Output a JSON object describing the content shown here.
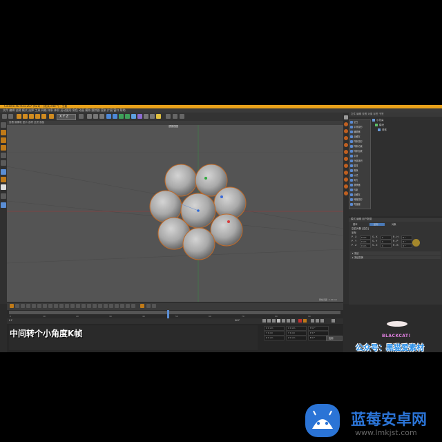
{
  "window": {
    "title": "Cinema 4D R21.207 (R21) - [花朵.c4d *] - 主要",
    "menu": "文件  编辑  创建  模式  选择  工具  网格  样条  体积  运动图形  角色  动画  模拟  跟踪器  渲染  扩展  窗口  帮助",
    "accent_color": "#e8a11a"
  },
  "toolbar": {
    "axis_labels": "X Y Z"
  },
  "viewport": {
    "header": "查看  摄像机  显示  选项  过滤  面板",
    "label": "透视视图",
    "grid_note": "网格间距 : 100 cm"
  },
  "object_manager": {
    "menu": "文件  编辑  查看  对象  标签  书签",
    "dropdown_items": [
      "空白",
      "平滑变形",
      "编辑器",
      "点缓存",
      "样条变形",
      "样条约束",
      "样条包裹",
      "平滑",
      "外部体积",
      "碰撞",
      "置换",
      "公式",
      "风力",
      "漂移器",
      "约束",
      "点缓存",
      "网格变形",
      "弯曲器"
    ],
    "objects": [
      "小花朵",
      "模块",
      "球体"
    ]
  },
  "attributes": {
    "tabs": "模式  编辑  用户数据",
    "sub_tabs": [
      "基本",
      "坐标",
      "对象"
    ],
    "title": "空白对象 [空白]",
    "section": "坐标",
    "rows": [
      {
        "label": "P . X",
        "value": "0 cm",
        "label2": "S . X",
        "value2": "1",
        "label3": "R . H",
        "value3": "0 °"
      },
      {
        "label": "P . Y",
        "value": "0 cm",
        "label2": "S . Y",
        "value2": "1",
        "label3": "R . P",
        "value3": "0 °"
      },
      {
        "label": "P . Z",
        "value": "0 cm",
        "label2": "S . Z",
        "value2": "1",
        "label3": "R . B",
        "value3": "0 °"
      }
    ],
    "group1": "▸ 冻结",
    "group2": "▸ 冻结变换"
  },
  "timeline": {
    "ticks": [
      "0",
      "10",
      "20",
      "30",
      "40",
      "50",
      "60",
      "70",
      "80",
      "90"
    ],
    "start": "0 F",
    "end": "90 F",
    "current": "0 F"
  },
  "coords": {
    "rows": [
      [
        "X  0 cm",
        "X  0 cm",
        "H  0 °"
      ],
      [
        "Y  0 cm",
        "Y  0 cm",
        "P  0 °"
      ],
      [
        "Z  0 cm",
        "Z  0 cm",
        "B  0 °"
      ]
    ],
    "apply": "应用"
  },
  "overlay": {
    "subtitle": "中间转个小角度K帧",
    "logo": "BLACKCAT!",
    "wechat": "公众号：黑猫爱素材",
    "watermark_name": "蓝莓安卓网",
    "watermark_url": "www.lmkjst.com"
  }
}
